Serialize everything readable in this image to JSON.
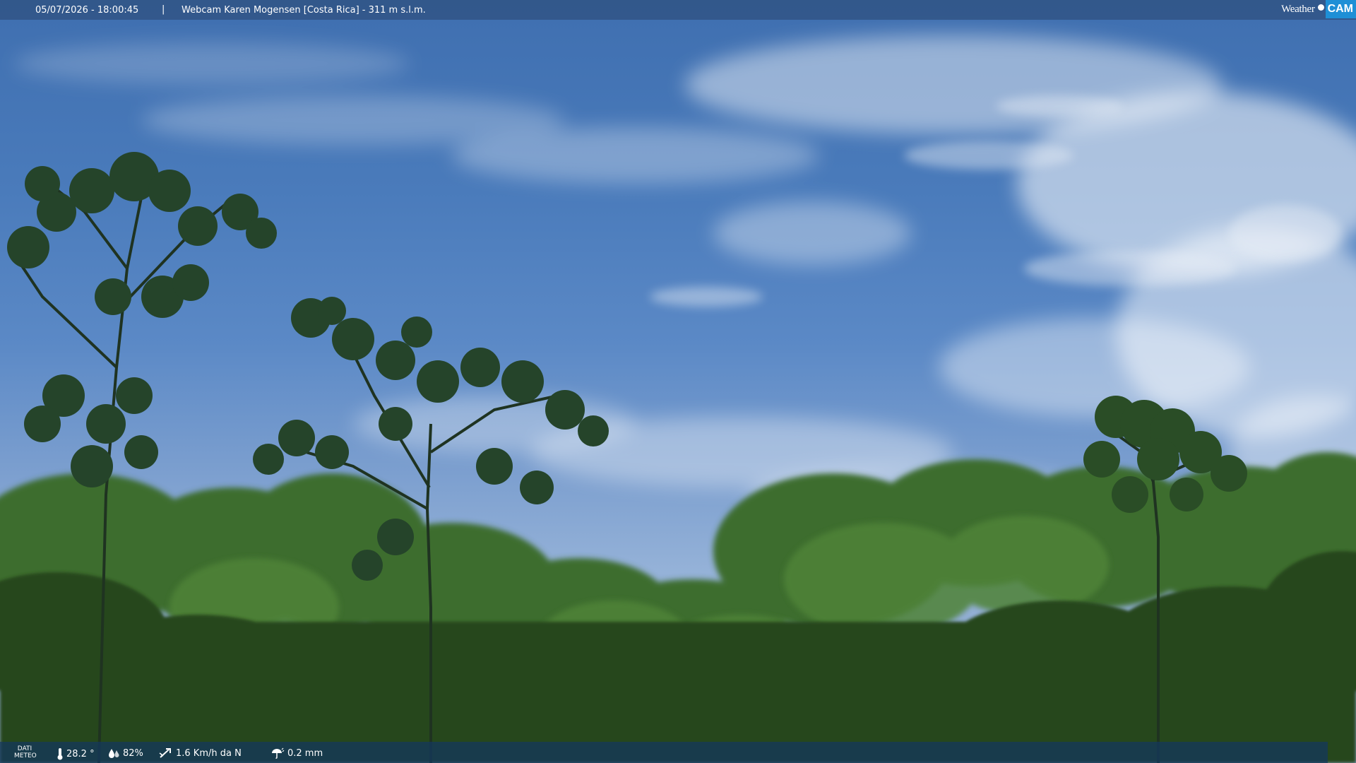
{
  "header": {
    "timestamp": "05/07/2026 - 18:00:45",
    "separator": "|",
    "title": "Webcam Karen Mogensen [Costa Rica]  - 311 m s.l.m.",
    "logo_left": "Weather",
    "logo_right": "CAM"
  },
  "footer": {
    "label_line1": "DATI",
    "label_line2": "METEO",
    "temperature": "28.2 °",
    "humidity": "82%",
    "wind": "1.6 Km/h da N",
    "rain": "0.2 mm"
  },
  "colors": {
    "logo_accent": "#1e8fd6",
    "sky": "#4a7bbb",
    "foliage": "#2f5a22"
  }
}
